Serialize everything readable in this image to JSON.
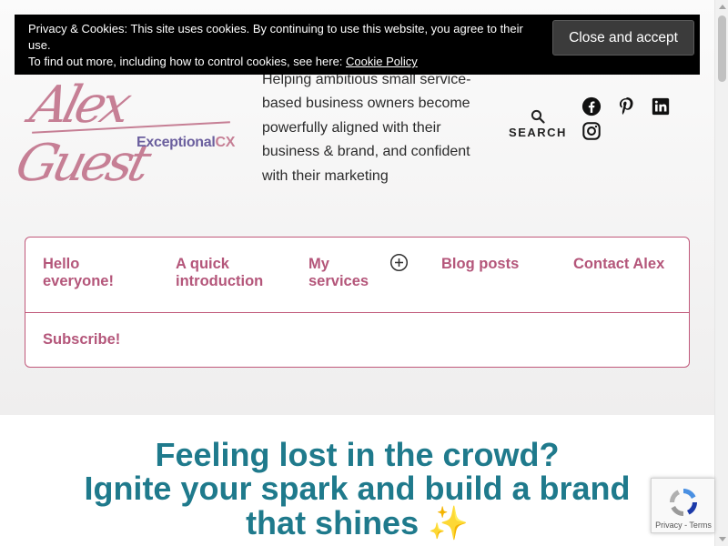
{
  "cookie_banner": {
    "line1": "Privacy & Cookies: This site uses cookies. By continuing to use this website, you agree to their use.",
    "line2_prefix": "To find out more, including how to control cookies, see here: ",
    "link_label": "Cookie Policy",
    "button_label": "Close and accept"
  },
  "logo": {
    "script": "Alex Guest",
    "sub_main": "Exceptional",
    "sub_accent": "CX"
  },
  "tagline": "Helping ambitious small service-based business owners become powerfully aligned with their business & brand, and confident with their marketing",
  "search": {
    "label": "SEARCH",
    "icon": "search-icon"
  },
  "social": [
    {
      "name": "facebook-icon"
    },
    {
      "name": "pinterest-icon"
    },
    {
      "name": "linkedin-icon"
    },
    {
      "name": "instagram-icon"
    }
  ],
  "nav": {
    "items": [
      {
        "line1": "Hello",
        "line2": "everyone!"
      },
      {
        "line1": "A quick",
        "line2": "introduction"
      },
      {
        "line1": "My",
        "line2": "services"
      },
      {
        "line1": "Blog posts",
        "line2": ""
      },
      {
        "line1": "Contact Alex",
        "line2": ""
      },
      {
        "line1": "Subscribe!",
        "line2": ""
      }
    ]
  },
  "hero": {
    "line1": "Feeling lost in the crowd?",
    "line2": "Ignite your spark and build a brand",
    "line3": "that shines ✨"
  },
  "recaptcha": {
    "terms": "Privacy - Terms"
  },
  "colors": {
    "accent": "#b4567a",
    "hero": "#1f7a8c",
    "nav_border": "#c0587a"
  }
}
